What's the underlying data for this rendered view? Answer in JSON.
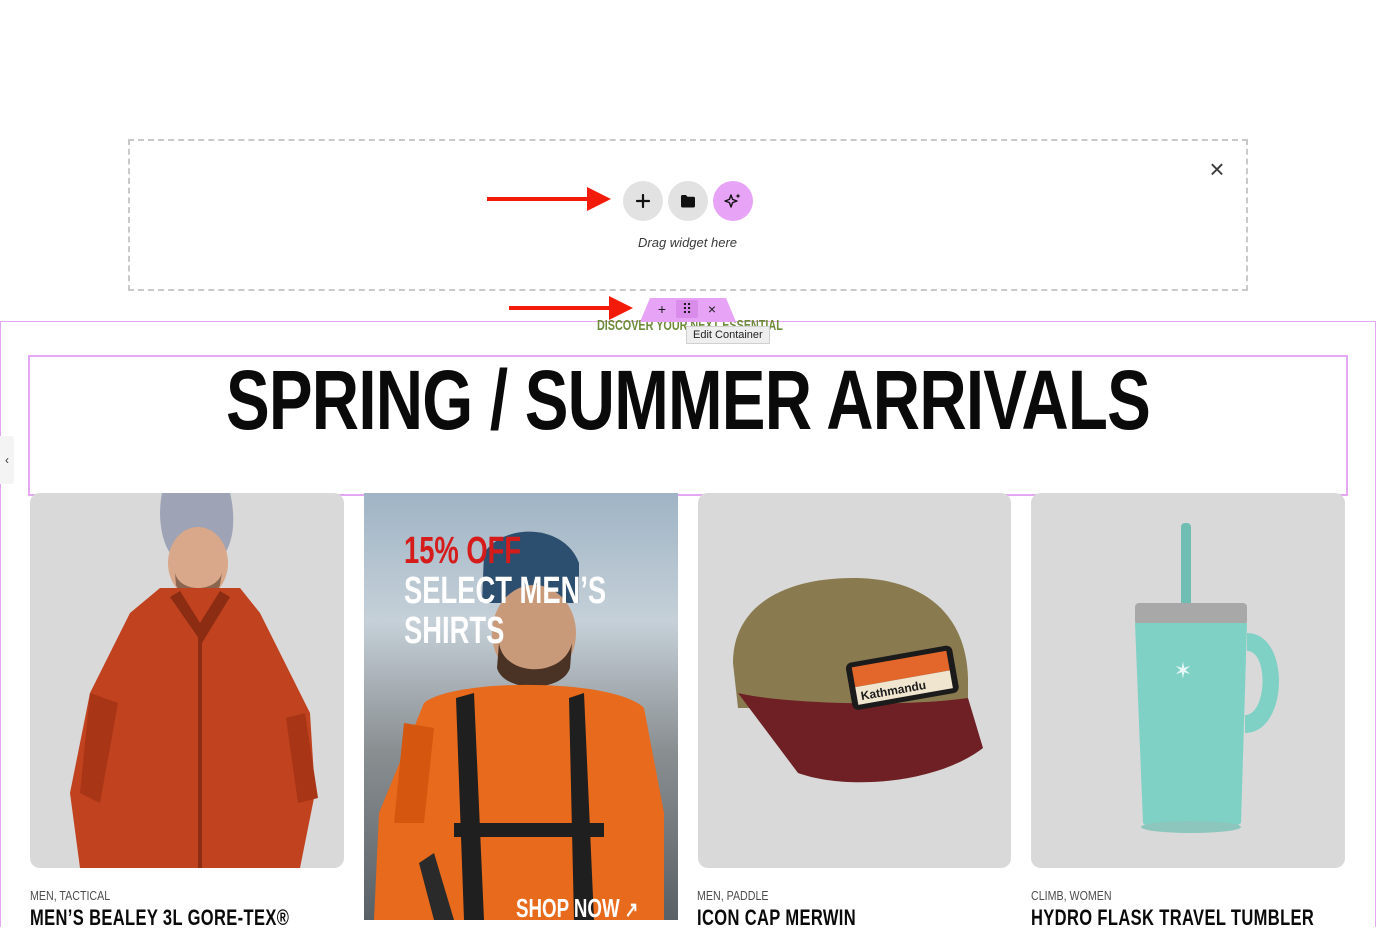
{
  "editor": {
    "drag_hint": "Drag widget here",
    "close_icon": "×",
    "tooltip": "Edit Container",
    "handle": {
      "add": "+",
      "move": "⠿",
      "close": "×"
    },
    "side_tab_icon": "‹",
    "accent_color": "#e7a3f5",
    "arrow_color": "#f21a09"
  },
  "section": {
    "eyebrow": "DISCOVER YOUR NEXT ESSENTIAL",
    "heading": "SPRING / SUMMER ARRIVALS"
  },
  "promo": {
    "line1": "15% OFF",
    "line2": "SELECT MEN’S",
    "line3": "SHIRTS",
    "cta": "SHOP NOW",
    "cta_icon": "↗"
  },
  "products": [
    {
      "cat1": "MEN",
      "cat2": "TACTICAL",
      "name": "MEN’S BEALEY 3L GORE-TEX®"
    },
    {
      "cat1": "MEN",
      "cat2": "PADDLE",
      "name": "ICON CAP MERWIN"
    },
    {
      "cat1": "CLIMB",
      "cat2": "WOMEN",
      "name": "HYDRO FLASK TRAVEL TUMBLER"
    }
  ],
  "product_brand_text": "Kathmandu"
}
